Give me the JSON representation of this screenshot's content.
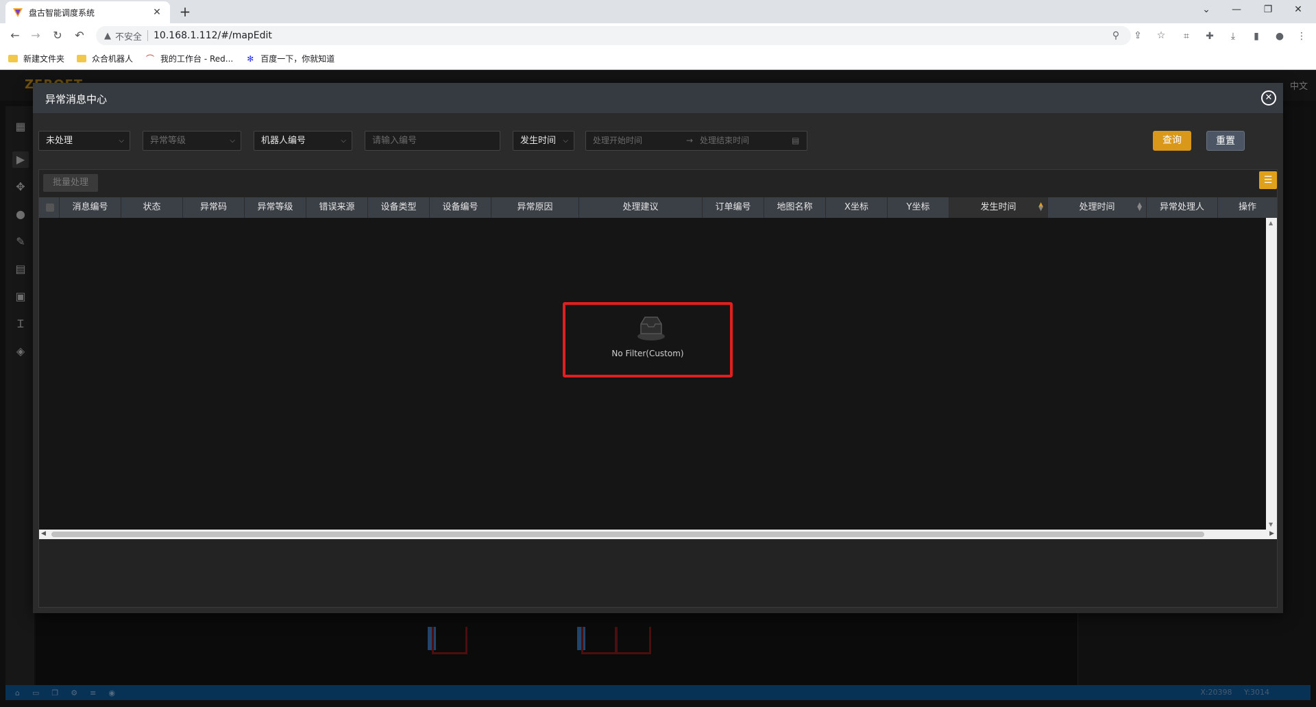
{
  "browser": {
    "tab_title": "盘古智能调度系统",
    "new_tab": "+",
    "url": "10.168.1.112/#/mapEdit",
    "security_label": "不安全",
    "bookmarks": [
      {
        "label": "新建文件夹"
      },
      {
        "label": "众合机器人"
      },
      {
        "label": "我的工作台 - Red..."
      },
      {
        "label": "百度一下，你就知道"
      }
    ]
  },
  "app": {
    "logo": "ZEROET",
    "language": "中文",
    "status": {
      "x": "X:20398",
      "y": "Y:3014"
    }
  },
  "dialog": {
    "title": "异常消息中心",
    "filters": {
      "status_value": "未处理",
      "level_placeholder": "异常等级",
      "robot_value": "机器人编号",
      "number_placeholder": "请输入编号",
      "time_type_value": "发生时间",
      "start_placeholder": "处理开始时间",
      "range_arrow": "→",
      "end_placeholder": "处理结束时间"
    },
    "buttons": {
      "query": "查询",
      "reset": "重置",
      "batch": "批量处理"
    },
    "columns": [
      "消息编号",
      "状态",
      "异常码",
      "异常等级",
      "错误来源",
      "设备类型",
      "设备编号",
      "异常原因",
      "处理建议",
      "订单编号",
      "地图名称",
      "X坐标",
      "Y坐标",
      "发生时间",
      "处理时间",
      "异常处理人",
      "操作"
    ],
    "empty_text": "No Filter(Custom)"
  },
  "colors": {
    "accent": "#d9981a",
    "dialog_header": "#363b42",
    "highlight_border": "#e02020"
  }
}
